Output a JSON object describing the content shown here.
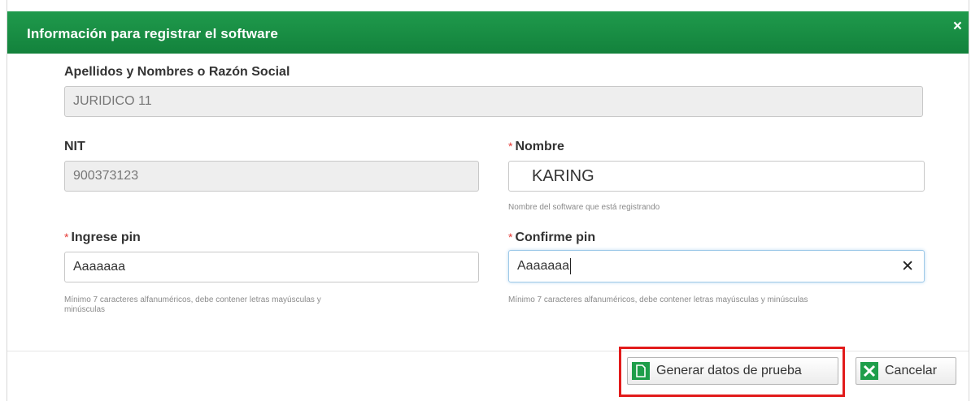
{
  "dialog": {
    "title": "Información para registrar el software",
    "close_glyph": "×"
  },
  "form": {
    "razon_social": {
      "label": "Apellidos y Nombres o Razón Social",
      "value": "JURIDICO 11"
    },
    "nit": {
      "label": "NIT",
      "value": "900373123"
    },
    "nombre": {
      "required_mark": "*",
      "label": "Nombre",
      "value": "KARING",
      "help": "Nombre del software que está registrando"
    },
    "pin": {
      "required_mark": "*",
      "label": "Ingrese pin",
      "value": "Aaaaaaa",
      "help_line1": "Mínimo 7 caracteres alfanuméricos, debe contener letras mayúsculas y",
      "help_line2": "minúsculas"
    },
    "confirm_pin": {
      "required_mark": "*",
      "label": "Confirme pin",
      "value": "Aaaaaaa",
      "clear_glyph": "✕",
      "help": "Mínimo 7 caracteres alfanuméricos, debe contener letras mayúsculas y minúsculas"
    }
  },
  "buttons": {
    "generate": {
      "label": "Generar datos de prueba",
      "icon": "document-icon"
    },
    "cancel": {
      "label": "Cancelar",
      "icon": "x-icon"
    }
  },
  "colors": {
    "header": "#1a8f45",
    "highlight": "#e21b1b",
    "required": "#e53935"
  }
}
